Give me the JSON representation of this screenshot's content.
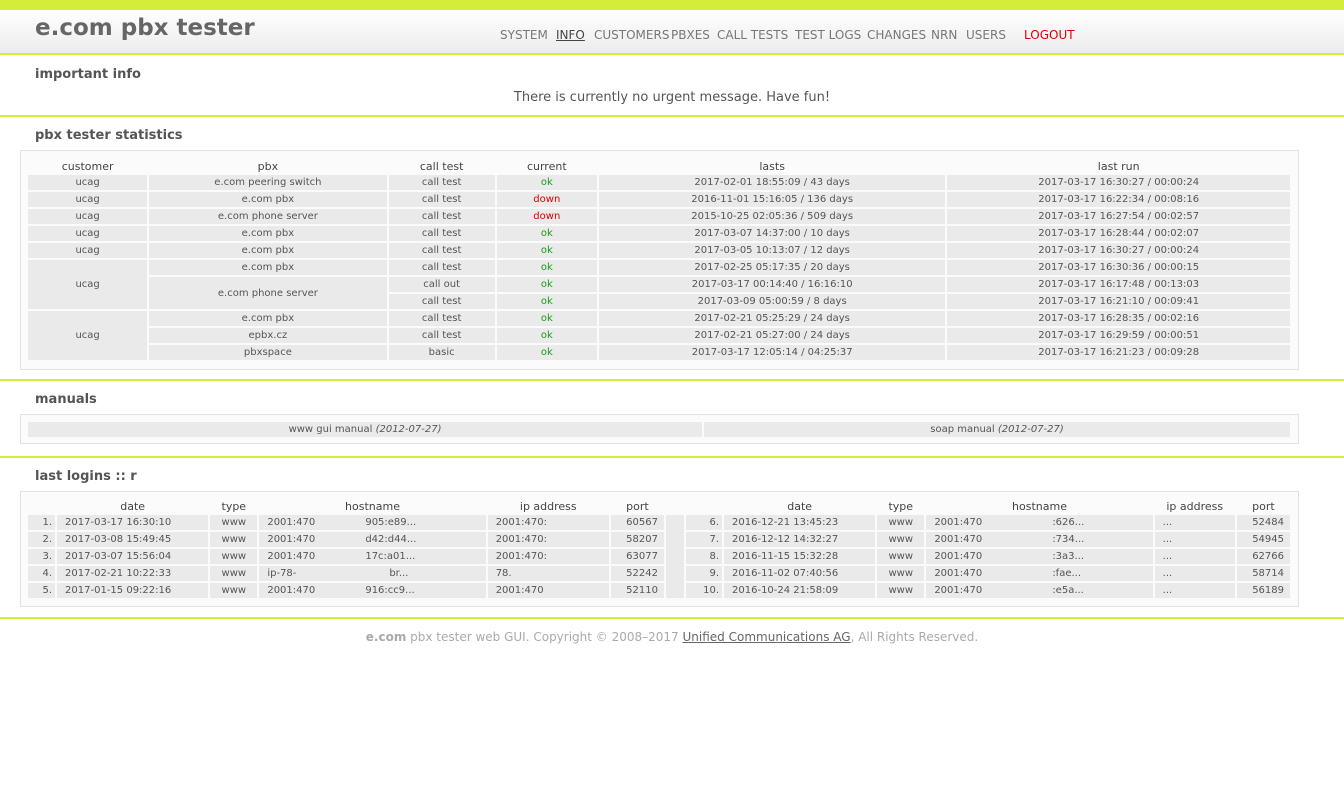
{
  "app": {
    "title": "e.com pbx tester"
  },
  "nav": [
    {
      "label": "SYSTEM",
      "active": false
    },
    {
      "label": "INFO",
      "active": true
    },
    {
      "label": "CUSTOMERS",
      "active": false
    },
    {
      "label": "PBXES",
      "active": false
    },
    {
      "label": "CALL TESTS",
      "active": false
    },
    {
      "label": "TEST LOGS",
      "active": false
    },
    {
      "label": "CHANGES",
      "active": false
    },
    {
      "label": "NRN",
      "active": false
    },
    {
      "label": "USERS",
      "active": false
    }
  ],
  "logout_label": "LOGOUT",
  "important": {
    "title": "important info",
    "message": "There is currently no urgent message. Have fun!"
  },
  "stats": {
    "title": "pbx tester statistics",
    "headers": [
      "customer",
      "pbx",
      "call test",
      "current",
      "lasts",
      "last run"
    ],
    "rows": [
      {
        "customer": "ucag",
        "pbx": "e.com peering switch",
        "test": "call test",
        "current": "ok",
        "lasts": "2017-02-01 18:55:09 / 43 days",
        "last_run": "2017-03-17 16:30:27 / 00:00:24"
      },
      {
        "customer": "ucag",
        "pbx": "e.com pbx",
        "test": "call test",
        "current": "down",
        "lasts": "2016-11-01 15:16:05 / 136 days",
        "last_run": "2017-03-17 16:22:34 / 00:08:16"
      },
      {
        "customer": "ucag",
        "pbx": "e.com phone server",
        "test": "call test",
        "current": "down",
        "lasts": "2015-10-25 02:05:36 / 509 days",
        "last_run": "2017-03-17 16:27:54 / 00:02:57"
      },
      {
        "customer": "ucag",
        "pbx": "e.com pbx",
        "test": "call test",
        "current": "ok",
        "lasts": "2017-03-07 14:37:00 / 10 days",
        "last_run": "2017-03-17 16:28:44 / 00:02:07"
      },
      {
        "customer": "ucag",
        "pbx": "e.com pbx",
        "test": "call test",
        "current": "ok",
        "lasts": "2017-03-05 10:13:07 / 12 days",
        "last_run": "2017-03-17 16:30:27 / 00:00:24"
      },
      {
        "customer": "ucag",
        "pbx": "e.com pbx",
        "test": "call test",
        "current": "ok",
        "lasts": "2017-02-25 05:17:35 / 20 days",
        "last_run": "2017-03-17 16:30:36 / 00:00:15"
      },
      {
        "customer": "",
        "pbx": "e.com phone server",
        "test": "call out",
        "current": "ok",
        "lasts": "2017-03-17 00:14:40 / 16:16:10",
        "last_run": "2017-03-17 16:17:48 / 00:13:03"
      },
      {
        "customer": "",
        "pbx": "",
        "test": "call test",
        "current": "ok",
        "lasts": "2017-03-09 05:00:59 / 8 days",
        "last_run": "2017-03-17 16:21:10 / 00:09:41"
      },
      {
        "customer": "ucag",
        "pbx": "e.com pbx",
        "test": "call test",
        "current": "ok",
        "lasts": "2017-02-21 05:25:29 / 24 days",
        "last_run": "2017-03-17 16:28:35 / 00:02:16"
      },
      {
        "customer": "",
        "pbx": "epbx.cz",
        "test": "call test",
        "current": "ok",
        "lasts": "2017-02-21 05:27:00 / 24 days",
        "last_run": "2017-03-17 16:29:59 / 00:00:51"
      },
      {
        "customer": "",
        "pbx": "pbxspace",
        "test": "basic",
        "current": "ok",
        "lasts": "2017-03-17 12:05:14 / 04:25:37",
        "last_run": "2017-03-17 16:21:23 / 00:09:28"
      }
    ]
  },
  "manuals": {
    "title": "manuals",
    "items": [
      {
        "label": "www gui manual",
        "date": "(2012-07-27)"
      },
      {
        "label": "soap manual",
        "date": "(2012-07-27)"
      }
    ]
  },
  "logins": {
    "title": "last logins :: r",
    "headers": [
      "date",
      "type",
      "hostname",
      "ip address",
      "port"
    ],
    "left": [
      {
        "n": "1.",
        "date": "2017-03-17 16:30:10",
        "type": "www",
        "host1": "2001:470",
        "host2": "905:e89...",
        "ip": "2001:470:",
        "port": "60567"
      },
      {
        "n": "2.",
        "date": "2017-03-08 15:49:45",
        "type": "www",
        "host1": "2001:470",
        "host2": "d42:d44...",
        "ip": "2001:470:",
        "port": "58207"
      },
      {
        "n": "3.",
        "date": "2017-03-07 15:56:04",
        "type": "www",
        "host1": "2001:470",
        "host2": "17c:a01...",
        "ip": "2001:470:",
        "port": "63077"
      },
      {
        "n": "4.",
        "date": "2017-02-21 10:22:33",
        "type": "www",
        "host1": "ip-78-",
        "host2": "br...",
        "ip": "78.",
        "port": "52242"
      },
      {
        "n": "5.",
        "date": "2017-01-15 09:22:16",
        "type": "www",
        "host1": "2001:470",
        "host2": "916:cc9...",
        "ip": "2001:470",
        "port": "52110"
      }
    ],
    "right": [
      {
        "n": "6.",
        "date": "2016-12-21 13:45:23",
        "type": "www",
        "host1": "2001:470",
        "host2": ":626...",
        "ip": "...",
        "port": "52484"
      },
      {
        "n": "7.",
        "date": "2016-12-12 14:32:27",
        "type": "www",
        "host1": "2001:470",
        "host2": ":734...",
        "ip": "...",
        "port": "54945"
      },
      {
        "n": "8.",
        "date": "2016-11-15 15:32:28",
        "type": "www",
        "host1": "2001:470",
        "host2": ":3a3...",
        "ip": "...",
        "port": "62766"
      },
      {
        "n": "9.",
        "date": "2016-11-02 07:40:56",
        "type": "www",
        "host1": "2001:470",
        "host2": ":fae...",
        "ip": "...",
        "port": "58714"
      },
      {
        "n": "10.",
        "date": "2016-10-24 21:58:09",
        "type": "www",
        "host1": "2001:470",
        "host2": ":e5a...",
        "ip": "...",
        "port": "56189"
      }
    ]
  },
  "footer": {
    "brand": "e.com",
    "text": " pbx tester web GUI. Copyright © 2008–2017 ",
    "link": "Unified Communications AG",
    "suffix": ", All Rights Reserved."
  },
  "colors": {
    "accent": "#d4ec3a",
    "ok": "#1a9a1a",
    "down": "#e00000"
  }
}
